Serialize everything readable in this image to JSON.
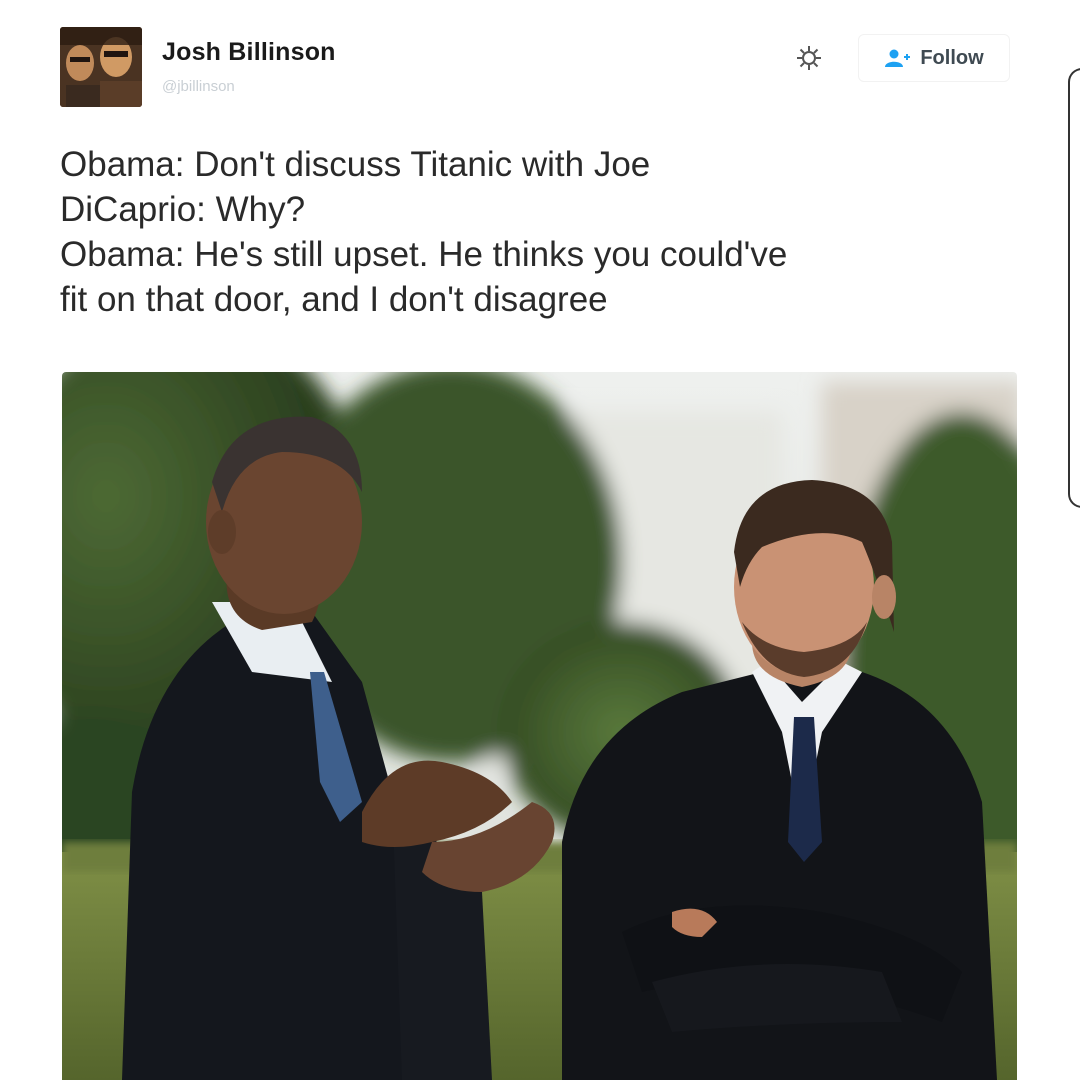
{
  "tweet": {
    "author_name": "Josh Billinson",
    "author_handle": "@jbillinson",
    "follow_label": "Follow",
    "lines": [
      "Obama: Don't discuss Titanic with Joe",
      "DiCaprio: Why?",
      "Obama: He's still upset. He thinks you could've",
      "fit on that door, and I don't disagree"
    ]
  },
  "icons": {
    "settings": "gear-icon",
    "follow": "add-user-icon"
  },
  "colors": {
    "follow_icon": "#1da1f2",
    "text": "#2a2a2a",
    "handle": "#c9cfd4"
  }
}
